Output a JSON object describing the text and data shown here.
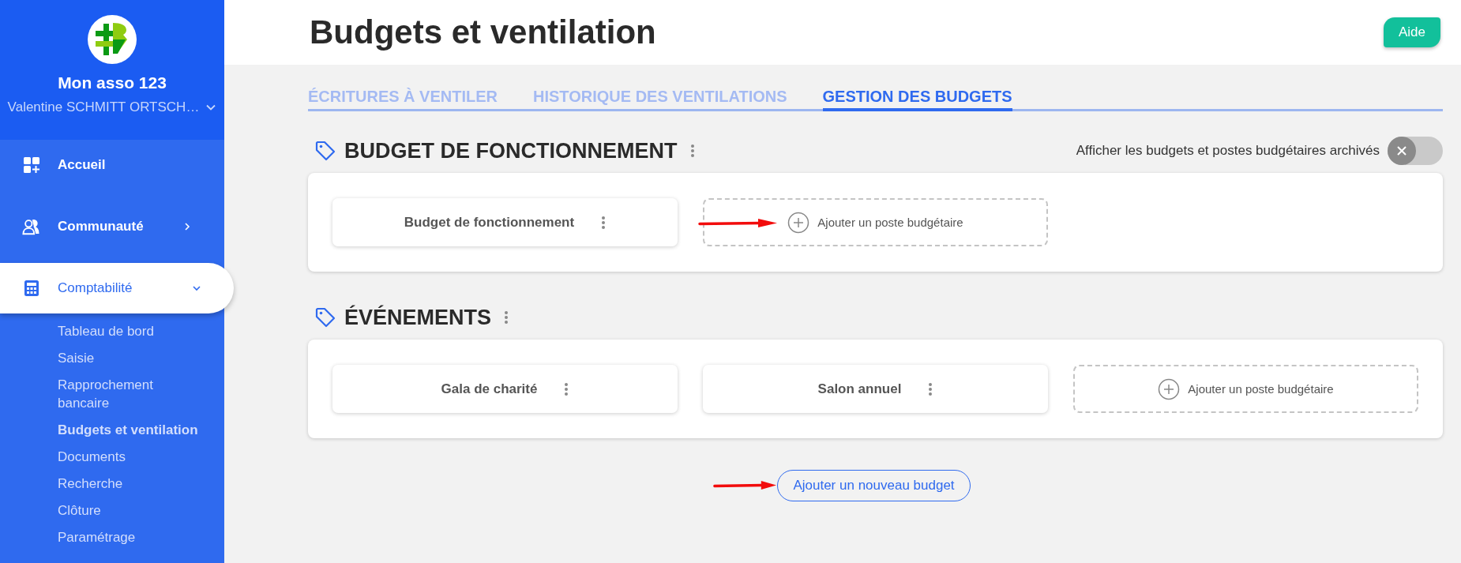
{
  "sidebar": {
    "org_name": "Mon asso 123",
    "user_name": "Valentine SCHMITT ORTSCH…",
    "nav": [
      {
        "label": "Accueil",
        "kind": "plain",
        "selected": false
      },
      {
        "label": "Communauté",
        "kind": "expandable",
        "expanded": false,
        "selected": false
      },
      {
        "label": "Comptabilité",
        "kind": "expandable",
        "expanded": true,
        "selected": true,
        "children": [
          {
            "label": "Tableau de bord",
            "selected": false
          },
          {
            "label": "Saisie",
            "selected": false
          },
          {
            "label": "Rapprochement bancaire",
            "selected": false
          },
          {
            "label": "Budgets et ventilation",
            "selected": true
          },
          {
            "label": "Documents",
            "selected": false
          },
          {
            "label": "Recherche",
            "selected": false
          },
          {
            "label": "Clôture",
            "selected": false
          },
          {
            "label": "Paramétrage",
            "selected": false
          }
        ]
      }
    ]
  },
  "header": {
    "title": "Budgets et ventilation",
    "help_button": "Aide"
  },
  "tabs": [
    {
      "label": "ÉCRITURES À VENTILER",
      "selected": false
    },
    {
      "label": "HISTORIQUE DES VENTILATIONS",
      "selected": false
    },
    {
      "label": "GESTION DES BUDGETS",
      "selected": true
    }
  ],
  "archive_toggle": {
    "label": "Afficher les budgets et postes budgétaires archivés",
    "on": false
  },
  "sections": [
    {
      "title": "BUDGET DE FONCTIONNEMENT",
      "items": [
        {
          "label": "Budget de fonctionnement"
        }
      ],
      "add_label": "Ajouter un poste budgétaire",
      "annotated": true
    },
    {
      "title": "ÉVÉNEMENTS",
      "items": [
        {
          "label": "Gala de charité"
        },
        {
          "label": "Salon annuel"
        }
      ],
      "add_label": "Ajouter un poste budgétaire",
      "annotated": false
    }
  ],
  "new_budget_button": {
    "label": "Ajouter un nouveau budget",
    "annotated": true
  }
}
